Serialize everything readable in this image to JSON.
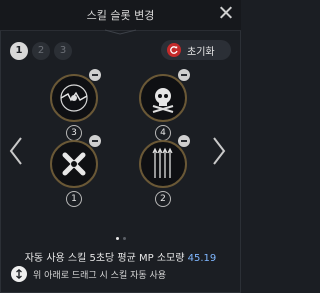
{
  "header": {
    "title": "스킬 슬롯 변경"
  },
  "pagination": {
    "pages": [
      "1",
      "2",
      "3"
    ],
    "active_index": 0
  },
  "reset_button": {
    "label": "초기화"
  },
  "slots": [
    {
      "badge": "3",
      "icon": "lightning-ring-skill-icon"
    },
    {
      "badge": "4",
      "icon": "skull-crossbones-skill-icon"
    },
    {
      "badge": "1",
      "icon": "crossed-bones-skill-icon"
    },
    {
      "badge": "2",
      "icon": "arrow-volley-skill-icon"
    }
  ],
  "carousel": {
    "pages": 2,
    "active_page": 0
  },
  "mp_summary": {
    "label": "자동 사용 스킬 5초당 평균 MP 소모량",
    "value": "45.19"
  },
  "hint": {
    "text": "위 아래로 드래그 시 스킬 자동 사용"
  },
  "colors": {
    "accent": "#c42a2a",
    "mp_value": "#7fb7ff",
    "slot_border": "#6a5836"
  }
}
